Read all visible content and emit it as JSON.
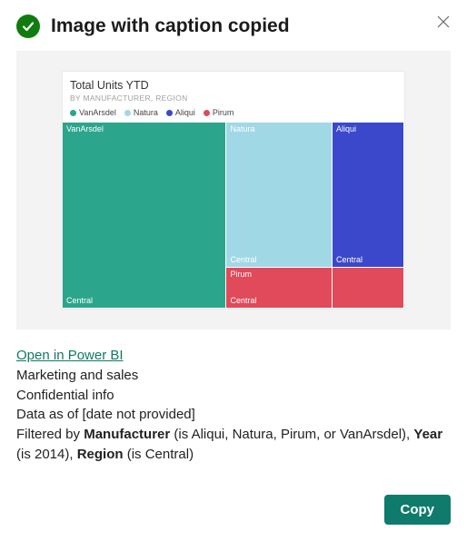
{
  "header": {
    "title": "Image with caption copied"
  },
  "chart_data": {
    "type": "table",
    "title": "Total Units YTD",
    "subtitle": "BY MANUFACTURER, REGION",
    "legend": [
      {
        "name": "VanArsdel",
        "color": "#2ca58d"
      },
      {
        "name": "Natura",
        "color": "#a1d8e6"
      },
      {
        "name": "Aliqui",
        "color": "#3b48cc"
      },
      {
        "name": "Pirum",
        "color": "#e04a5a"
      }
    ],
    "cells": [
      {
        "manufacturer": "VanArsdel",
        "region": "Central",
        "share_pct": 48,
        "color": "#2ca58d",
        "col": 0,
        "height_pct": 100
      },
      {
        "manufacturer": "Natura",
        "region": "Central",
        "share_pct": 22,
        "color": "#a1d8e6",
        "col": 1,
        "height_pct": 78
      },
      {
        "manufacturer": "Pirum",
        "region": "Central",
        "share_pct": 9,
        "color": "#e04a5a",
        "col": 1,
        "height_pct": 22
      },
      {
        "manufacturer": "Aliqui",
        "region": "Central",
        "share_pct": 16,
        "color": "#3b48cc",
        "col": 2,
        "height_pct": 78
      },
      {
        "manufacturer": "",
        "region": "",
        "share_pct": 5,
        "color": "#e04a5a",
        "col": 2,
        "height_pct": 22
      }
    ],
    "col_widths_pct": [
      48,
      31,
      21
    ]
  },
  "caption": {
    "link_text": "Open in Power BI",
    "report_name": "Marketing and sales",
    "classification": "Confidential info",
    "data_as_of_prefix": "Data as of ",
    "data_as_of_value": "[date not provided]",
    "filter_prefix": "Filtered by ",
    "filter_field_1": "Manufacturer",
    "filter_value_1": " (is Aliqui, Natura, Pirum, or VanArsdel), ",
    "filter_field_2": "Year",
    "filter_value_2": " (is 2014), ",
    "filter_field_3": "Region",
    "filter_value_3": " (is Central)"
  },
  "footer": {
    "copy_label": "Copy"
  }
}
